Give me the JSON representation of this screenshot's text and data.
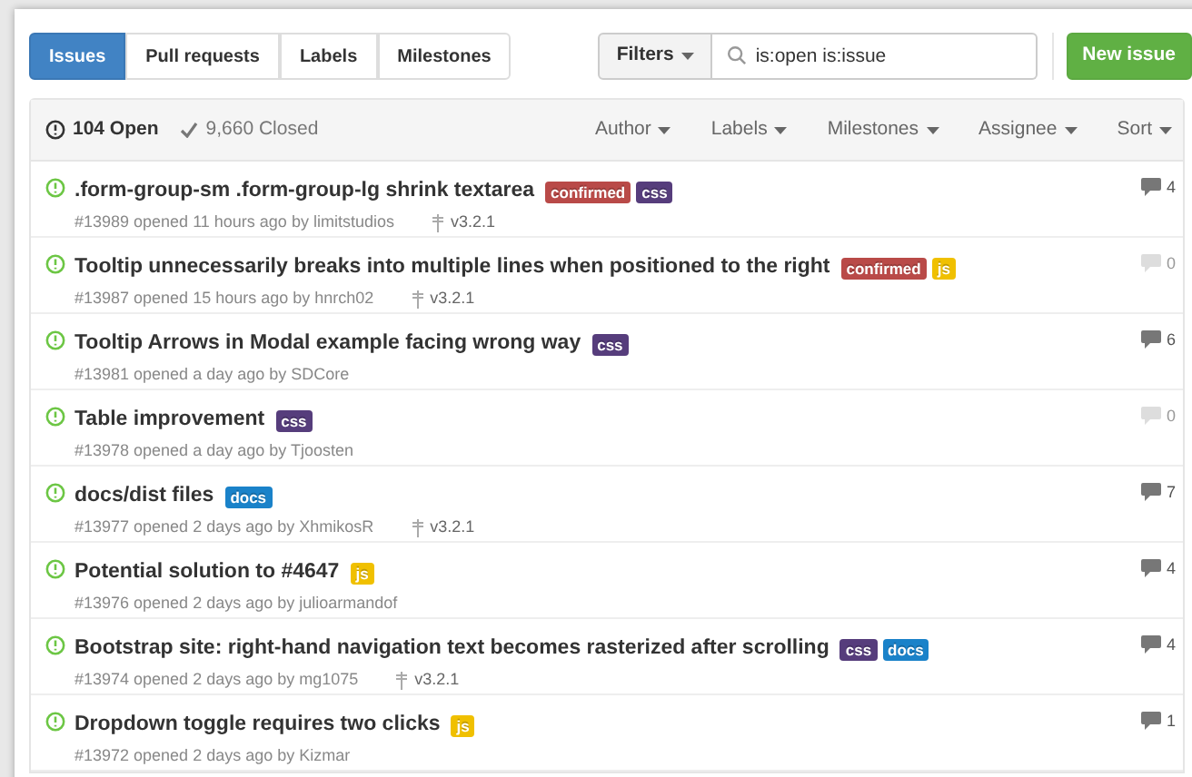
{
  "tabs": [
    {
      "label": "Issues",
      "selected": true
    },
    {
      "label": "Pull requests",
      "selected": false
    },
    {
      "label": "Labels",
      "selected": false
    },
    {
      "label": "Milestones",
      "selected": false
    }
  ],
  "filters_button": "Filters",
  "search": {
    "value": "is:open is:issue"
  },
  "new_issue_button": "New issue",
  "header": {
    "open_count": "104 Open",
    "closed_count": "9,660 Closed",
    "filters": [
      "Author",
      "Labels",
      "Milestones",
      "Assignee",
      "Sort"
    ]
  },
  "issues": [
    {
      "title": ".form-group-sm .form-group-lg shrink textarea",
      "labels": [
        {
          "name": "confirmed",
          "color": "#b94a48"
        },
        {
          "name": "css",
          "color": "#563d7c"
        }
      ],
      "meta": "#13989 opened 11 hours ago by limitstudios",
      "milestone": "v3.2.1",
      "comments": "4",
      "faded": false
    },
    {
      "title": "Tooltip unnecessarily breaks into multiple lines when positioned to the right",
      "labels": [
        {
          "name": "confirmed",
          "color": "#b94a48"
        },
        {
          "name": "js",
          "color": "#f0c000"
        }
      ],
      "meta": "#13987 opened 15 hours ago by hnrch02",
      "milestone": "v3.2.1",
      "comments": "0",
      "faded": true
    },
    {
      "title": "Tooltip Arrows in Modal example facing wrong way",
      "labels": [
        {
          "name": "css",
          "color": "#563d7c"
        }
      ],
      "meta": "#13981 opened a day ago by SDCore",
      "comments": "6",
      "faded": false
    },
    {
      "title": "Table improvement",
      "labels": [
        {
          "name": "css",
          "color": "#563d7c"
        }
      ],
      "meta": "#13978 opened a day ago by Tjoosten",
      "comments": "0",
      "faded": true
    },
    {
      "title": "docs/dist files",
      "labels": [
        {
          "name": "docs",
          "color": "#1a82c9"
        }
      ],
      "meta": "#13977 opened 2 days ago by XhmikosR",
      "milestone": "v3.2.1",
      "comments": "7",
      "faded": false
    },
    {
      "title": "Potential solution to #4647",
      "labels": [
        {
          "name": "js",
          "color": "#f0c000"
        }
      ],
      "meta": "#13976 opened 2 days ago by julioarmandof",
      "comments": "4",
      "faded": false
    },
    {
      "title": "Bootstrap site: right-hand navigation text becomes rasterized after scrolling",
      "labels": [
        {
          "name": "css",
          "color": "#563d7c"
        },
        {
          "name": "docs",
          "color": "#1a82c9"
        }
      ],
      "meta": "#13974 opened 2 days ago by mg1075",
      "milestone": "v3.2.1",
      "comments": "4",
      "faded": false
    },
    {
      "title": "Dropdown toggle requires two clicks",
      "labels": [
        {
          "name": "js",
          "color": "#f0c000"
        }
      ],
      "meta": "#13972 opened 2 days ago by Kizmar",
      "comments": "1",
      "faded": false
    }
  ]
}
